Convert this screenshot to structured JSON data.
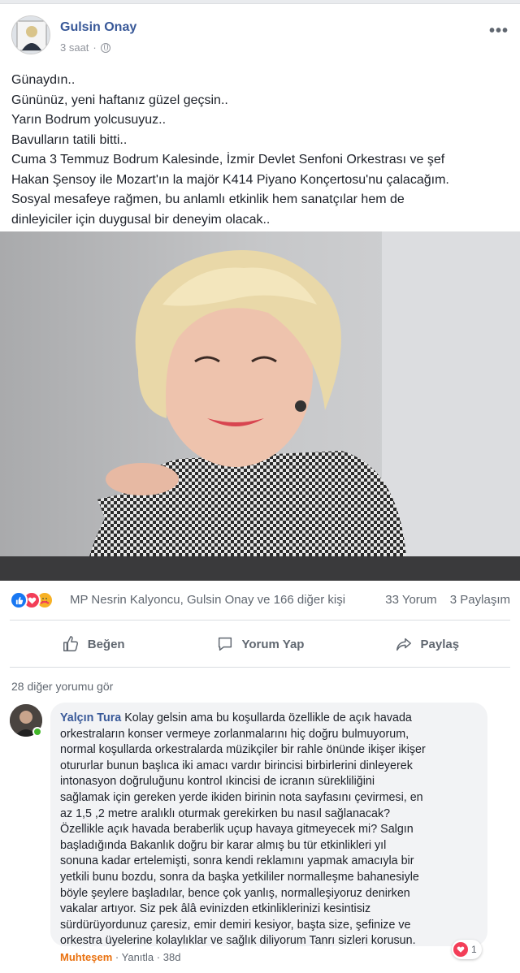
{
  "post": {
    "author": "Gulsin Onay",
    "time": "3 saat",
    "separator": "·",
    "more_icon": "more-horizontal-icon",
    "privacy_icon": "globe-icon",
    "lines": [
      "Günaydın..",
      "Gününüz, yeni haftanız güzel geçsin..",
      "Yarın Bodrum yolcusuyuz..",
      "Bavulların tatili bitti..",
      "Cuma 3 Temmuz Bodrum Kalesinde, İzmir Devlet Senfoni Orkestrası ve şef",
      "Hakan Şensoy ile Mozart'ın la majör K414 Piyano Konçertosu'nu çalacağım.",
      "Sosyal mesafeye rağmen, bu anlamlı etkinlik hem sanatçılar hem de",
      "dinleyiciler için duygusal bir deneyim olacak.."
    ]
  },
  "reactions": {
    "icons": [
      "like-icon",
      "love-icon",
      "care-icon"
    ],
    "names": "MP Nesrin Kalyoncu, Gulsin Onay ve 166 diğer kişi",
    "comments": "33 Yorum",
    "shares": "3 Paylaşım"
  },
  "actions": {
    "like": "Beğen",
    "comment": "Yorum Yap",
    "share": "Paylaş"
  },
  "comments_section": {
    "more_comments": "28 diğer yorumu gör",
    "comment": {
      "author": "Yalçın Tura",
      "lines": [
        "Kolay gelsin ama bu koşullarda özellikle de açık havada",
        "orkestraların konser vermeye zorlanmalarını hiç doğru bulmuyorum,",
        "normal koşullarda orkestralarda müzikçiler bir rahle önünde ikişer ikişer",
        "otururlar bunun başlıca iki amacı vardır birincisi birbirlerini dinleyerek",
        "intonasyon doğruluğunu kontrol ıkincisi de icranın sürekliliğini",
        "sağlamak için gereken yerde ikiden birinin nota sayfasını çevirmesi, en",
        "az 1,5 ,2 metre aralıklı oturmak gerekirken bu nasıl sağlanacak?",
        "Özellikle açık havada beraberlik uçup havaya gitmeyecek mi? Salgın",
        "başladığında Bakanlık doğru bir karar almış bu tür etkinlikleri yıl",
        "sonuna kadar ertelemişti, sonra kendi reklamını yapmak amacıyla bir",
        "yetkili bunu bozdu, sonra da başka yetkililer normalleşme bahanesiyle",
        "böyle şeylere başladılar, bence çok yanlış, normalleşiyoruz denirken",
        "vakalar artıyor. Siz pek âlâ evinizden etkinliklerinizi kesintisiz",
        "sürdürüyordunuz çaresiz, emir demiri kesiyor, başta size, şefinize ve",
        "orkestra üyelerine kolaylıklar ve sağlık diliyorum Tanrı sizleri korusun."
      ],
      "reaction_link": "Muhteşem",
      "reply": "Yanıtla",
      "age": "38d",
      "reaction_count": "1"
    }
  },
  "colors": {
    "link_blue": "#385898",
    "like_blue": "#1877f2",
    "love_red": "#f33e58",
    "care_yellow": "#f7b125",
    "wow_orange": "#e9710f",
    "online_green": "#42b72a"
  }
}
